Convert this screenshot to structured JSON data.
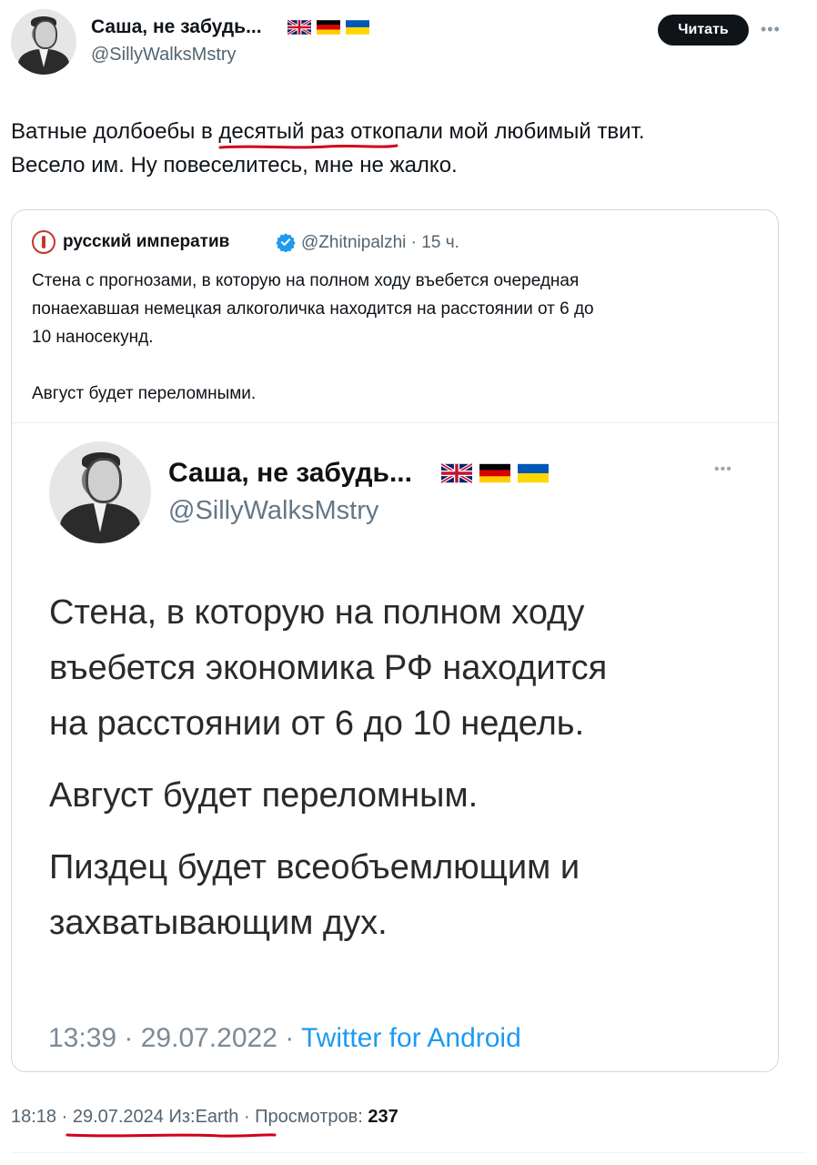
{
  "author": {
    "name": "Саша, не забудь...",
    "handle": "@SillyWalksMstry",
    "follow_label": "Читать",
    "flags": [
      "uk-flag",
      "germany-flag",
      "ukraine-flag"
    ]
  },
  "tweet": {
    "lines": [
      "Ватные долбоебы в десятый раз откопали мой любимый твит.",
      "Весело им. Ну повеселитесь, мне не жалко."
    ]
  },
  "quote": {
    "name": "русский императив",
    "handle_time": "@Zhitnipalzhi · 15 ч.",
    "lines": [
      "Стена с прогнозами, в которую на полном ходу въебется очередная",
      "понаехавшая немецкая алкоголичка находится на расстоянии от 6 до",
      "10 наносекунд."
    ],
    "line_after": "Август будет переломными."
  },
  "embedded": {
    "name": "Саша, не забудь...",
    "handle": "@SillyWalksMstry",
    "lines_1": [
      "Стена, в которую на полном ходу",
      "въебется экономика РФ находится",
      "на расстоянии от 6 до 10 недель."
    ],
    "line_2": "Август будет переломным.",
    "lines_3": [
      "Пиздец будет всеобъемлющим и",
      "захватывающим дух."
    ],
    "meta_time": "13:39 · 29.07.2022 · ",
    "meta_source": "Twitter for Android"
  },
  "footer": {
    "time": "18:18 · ",
    "date": "29.07.2024",
    "location": " Из:Earth · ",
    "views_label": "Просмотров: ",
    "views_count": "237"
  },
  "colors": {
    "accent": "#1d9bf0",
    "underline_marker": "#d0021b",
    "secondary_text": "#536471"
  }
}
